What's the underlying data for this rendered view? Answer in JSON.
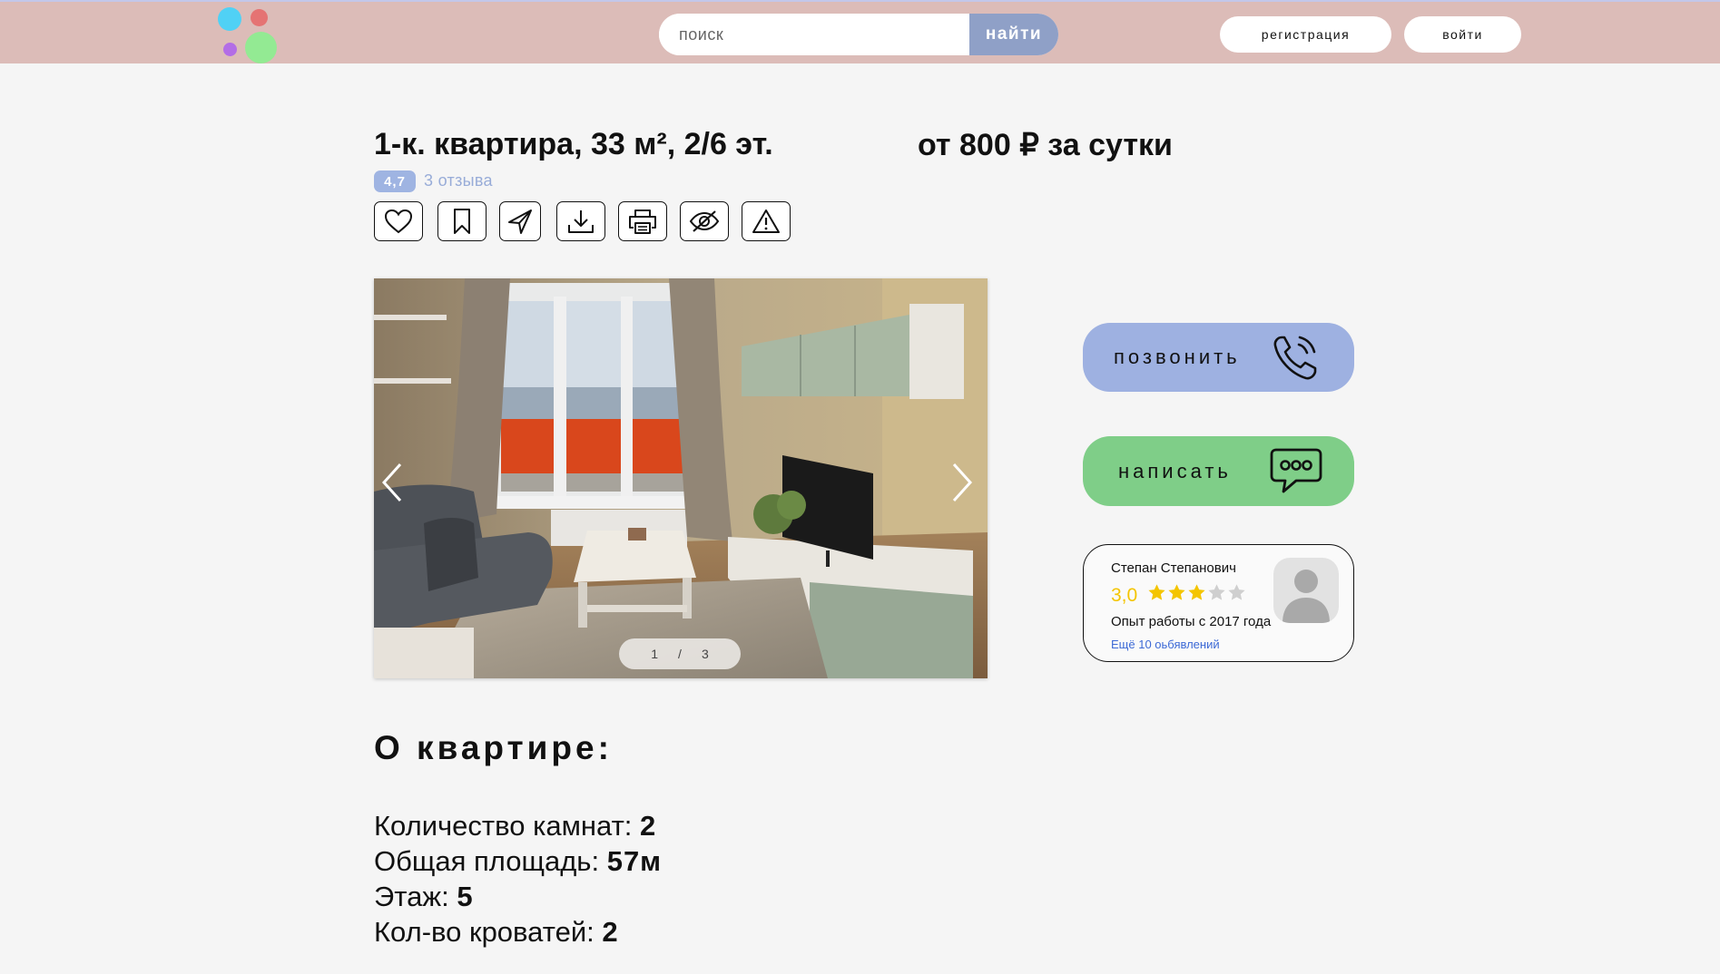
{
  "header": {
    "search_placeholder": "поиск",
    "search_button": "найти",
    "register_button": "регистрация",
    "login_button": "войти",
    "logo_colors": [
      "#50d1f5",
      "#e57373",
      "#b36de6",
      "#93ea93"
    ]
  },
  "listing": {
    "title": "1-к. квартира, 33 м², 2/6 эт.",
    "price": "от 800 ₽ за сутки",
    "rating": "4,7",
    "reviews": "3 отзыва"
  },
  "actions": [
    "heart-icon",
    "bookmark-icon",
    "share-icon",
    "download-icon",
    "print-icon",
    "hide-icon",
    "report-icon"
  ],
  "gallery": {
    "current": "1",
    "separator": "/",
    "total": "3"
  },
  "contact": {
    "call": "позвонить",
    "write": "написать",
    "call_color": "#9eb1e1",
    "write_color": "#7fce88"
  },
  "agent": {
    "name": "Степан Степанович",
    "score": "3,0",
    "stars_filled": 3,
    "stars_total": 5,
    "experience": "Опыт работы с 2017 года",
    "more_ads": "Ещё 10 оьбявлений"
  },
  "about": {
    "title": "О квартире:",
    "features": [
      {
        "label": "Количество камнат: ",
        "value": "2"
      },
      {
        "label": "Общая площадь: ",
        "value": "57м"
      },
      {
        "label": "Этаж: ",
        "value": "5"
      },
      {
        "label": "Кол-во кроватей: ",
        "value": "2"
      }
    ]
  }
}
